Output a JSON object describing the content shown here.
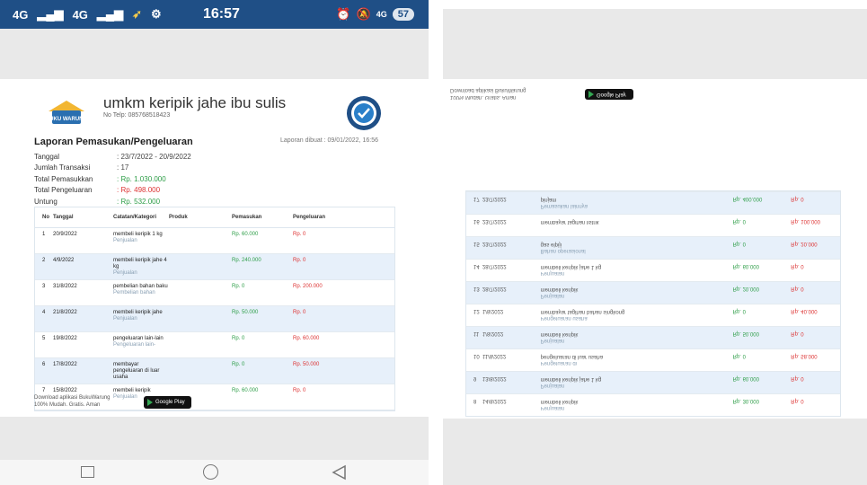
{
  "status_bar": {
    "signal_left": "4G",
    "signal_right": "4G",
    "time": "16:57",
    "network": "4G",
    "battery": "57"
  },
  "store": {
    "name": "umkm keripik jahe ibu sulis",
    "phone": "No Telp: 085768518423",
    "logo_text": "BUKU WARUNG"
  },
  "report": {
    "title": "Laporan Pemasukan/Pengeluaran",
    "created": "Laporan dibuat : 09/01/2022, 16:56",
    "summary": [
      {
        "label": "Tanggal",
        "value": ": 23/7/2022 - 20/9/2022",
        "color": ""
      },
      {
        "label": "Jumlah Transaksi",
        "value": ": 17",
        "color": ""
      },
      {
        "label": "Total Pemasukkan",
        "value": ": Rp. 1.030.000",
        "color": "green"
      },
      {
        "label": "Total Pengeluaran",
        "value": ": Rp. 498.000",
        "color": "red"
      },
      {
        "label": "Untung",
        "value": ": Rp. 532.000",
        "color": "green"
      }
    ]
  },
  "table": {
    "headers": [
      "No",
      "Tanggal",
      "Catatan/Kategori",
      "Produk",
      "Pemasukan",
      "Pengeluaran"
    ],
    "rows": [
      {
        "no": "1",
        "date": "20/9/2022",
        "note": "membeli keripik 1 kg",
        "category": "Penjualan",
        "product": "",
        "in": "Rp. 60.000",
        "out": "Rp. 0"
      },
      {
        "no": "2",
        "date": "4/9/2022",
        "note": "membeli keripik jahe 4 kg",
        "category": "Penjualan",
        "product": "",
        "in": "Rp. 240.000",
        "out": "Rp. 0"
      },
      {
        "no": "3",
        "date": "31/8/2022",
        "note": "pembelian bahan baku",
        "category": "Pembelian bahan",
        "product": "",
        "in": "Rp. 0",
        "out": "Rp. 200.000"
      },
      {
        "no": "4",
        "date": "21/8/2022",
        "note": "membeli keripik jahe",
        "category": "Penjualan",
        "product": "",
        "in": "Rp. 50.000",
        "out": "Rp. 0"
      },
      {
        "no": "5",
        "date": "19/8/2022",
        "note": "pengeluaran lain-lain",
        "category": "Pengeluaran lain-",
        "product": "",
        "in": "Rp. 0",
        "out": "Rp. 60.000"
      },
      {
        "no": "6",
        "date": "17/8/2022",
        "note": "membayar pengeluaran di luar usaha",
        "category": "",
        "product": "",
        "in": "Rp. 0",
        "out": "Rp. 50.000"
      },
      {
        "no": "7",
        "date": "15/8/2022",
        "note": "membeli keripik",
        "category": "Penjualan",
        "product": "",
        "in": "Rp. 60.000",
        "out": "Rp. 0"
      }
    ]
  },
  "footer": {
    "download_line1": "Download aplikasi BukuWarung",
    "download_line2": "100% Mudah. Gratis. Aman",
    "google_play": "Google Play"
  },
  "right_screen": {
    "download_line1": "Download aplikasi BukuWarung",
    "download_line2": "100% Mudah. Gratis. Aman",
    "google_play": "Google Play",
    "rows": [
      {
        "no": "8",
        "date": "14/8/2022",
        "note": "membeli keripik",
        "category": "Penjualan",
        "in": "Rp. 30.000",
        "out": "Rp. 0"
      },
      {
        "no": "9",
        "date": "13/8/2022",
        "note": "membeli keripik jahe 1 kg",
        "category": "Penjualan",
        "in": "Rp. 60.000",
        "out": "Rp. 0"
      },
      {
        "no": "10",
        "date": "11/8/2022",
        "note": "pengeluaran di luar usaha",
        "category": "Pengeluaran di",
        "in": "Rp. 0",
        "out": "Rp. 58.000"
      },
      {
        "no": "11",
        "date": "1/8/2022",
        "note": "membeli keripik",
        "category": "Penjualan",
        "in": "Rp. 50.000",
        "out": "Rp. 0"
      },
      {
        "no": "12",
        "date": "1/8/2022",
        "note": "membayar tagihan bahan singkong",
        "category": "Pengeluaran usaha",
        "in": "Rp. 0",
        "out": "Rp. 40.000"
      },
      {
        "no": "13",
        "date": "28/7/2022",
        "note": "membeli keripik",
        "category": "Penjualan",
        "in": "Rp. 20.000",
        "out": "Rp. 0"
      },
      {
        "no": "14",
        "date": "28/7/2022",
        "note": "membeli keripik jahe 1 kg",
        "category": "Penjualan",
        "in": "Rp. 60.000",
        "out": "Rp. 0"
      },
      {
        "no": "15",
        "date": "23/7/2022",
        "note": "gas elpiji",
        "category": "Bahan operasional",
        "in": "Rp. 0",
        "out": "Rp. 20.000"
      },
      {
        "no": "16",
        "date": "23/7/2022",
        "note": "membayar tagihan listrik",
        "category": "",
        "in": "Rp. 0",
        "out": "Rp. 100.000"
      },
      {
        "no": "17",
        "date": "23/7/2022",
        "note": "pinjam",
        "category": "Pemasukan lainnya",
        "in": "Rp. 400.000",
        "out": "Rp. 0"
      }
    ]
  },
  "colors": {
    "status_bar": "#1f4f86",
    "income": "#2e9e48",
    "expense": "#dd3333",
    "row_alt": "#e7f0fa"
  }
}
